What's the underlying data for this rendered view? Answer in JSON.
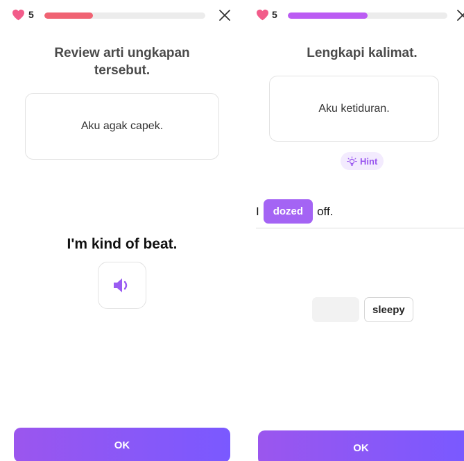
{
  "left_screen": {
    "hearts": "5",
    "progress": 0.3,
    "instruction": "Review arti ungkapan tersebut.",
    "card_text": "Aku agak capek.",
    "phrase": "I'm kind of beat.",
    "audio_icon": "speaker-icon",
    "ok_label": "OK"
  },
  "right_screen": {
    "hearts": "5",
    "progress": 0.5,
    "instruction": "Lengkapi kalimat.",
    "card_text": "Aku ketiduran.",
    "hint_label": "Hint",
    "sentence": {
      "before": "I",
      "filled_word": "dozed",
      "after": "off."
    },
    "word_bank": [
      "sleepy"
    ],
    "ok_label": "OK"
  },
  "colors": {
    "heart": "#f25c8a",
    "progress_left": "#f06373",
    "progress_right": "#bb5cf3",
    "accent_purple": "#8b57f5"
  }
}
